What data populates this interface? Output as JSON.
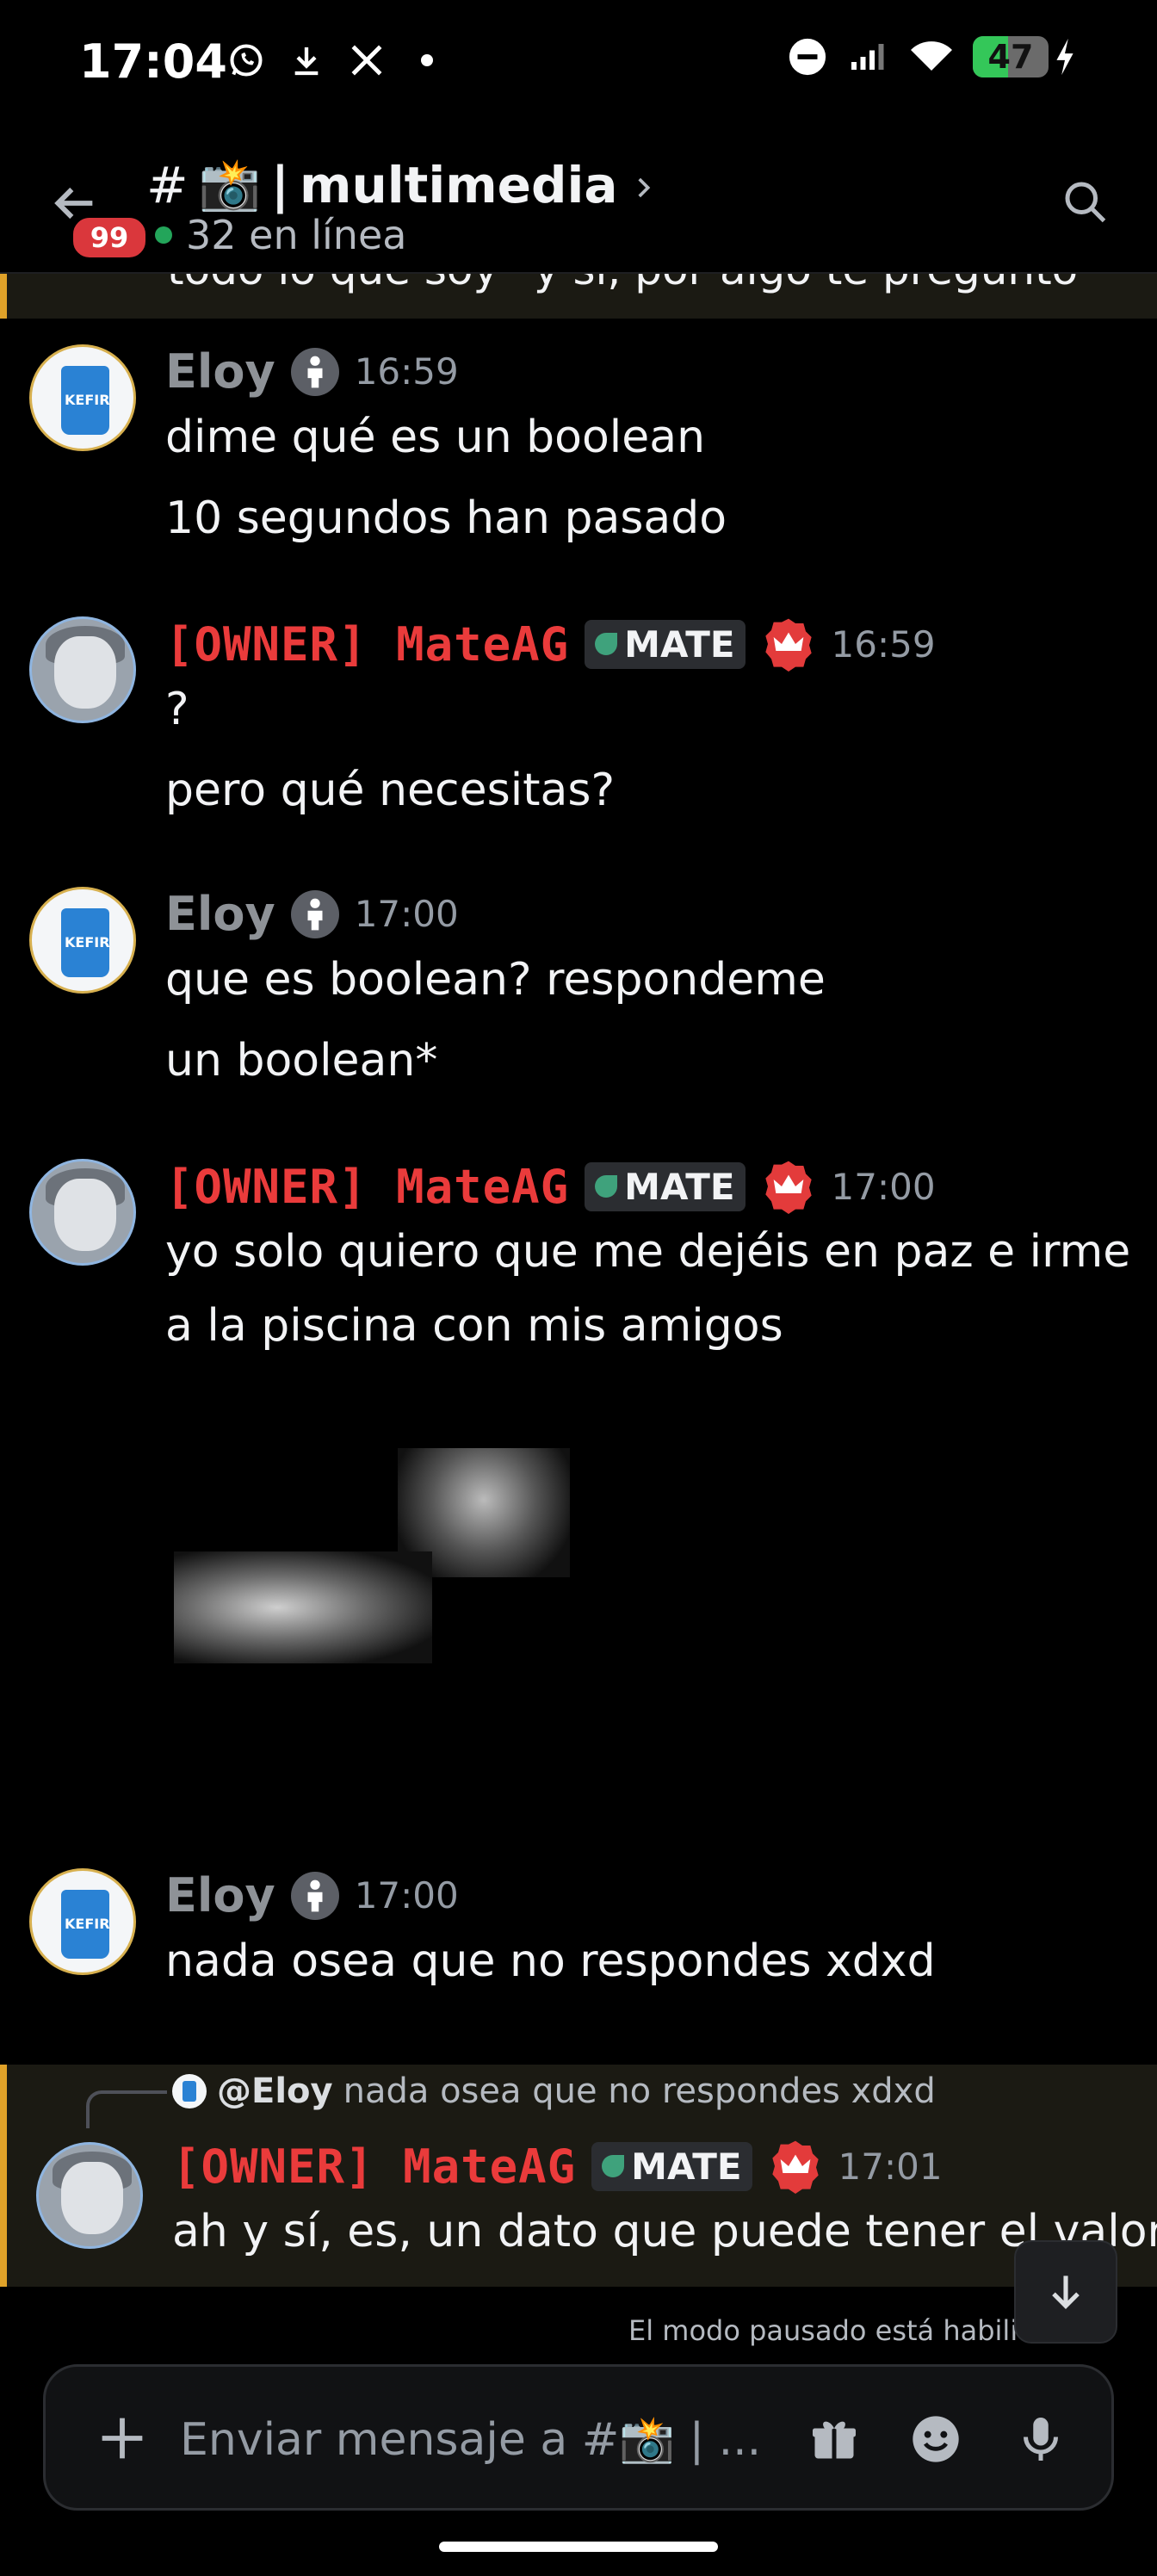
{
  "status_bar": {
    "time": "17:04",
    "left_icons": [
      "whatsapp-icon",
      "download-icon",
      "x-icon",
      "dot-icon"
    ],
    "right_icons": [
      "dnd-icon",
      "signal-icon",
      "wifi-icon",
      "battery-icon",
      "charging-icon"
    ],
    "battery_percent": "47",
    "battery_level": 0.47
  },
  "header": {
    "hash": "#",
    "channel_emoji": "📸",
    "separator": "|",
    "channel_name": "multimedia",
    "online_count": "32 en línea",
    "unread_badge": "99"
  },
  "cut_message": {
    "text": "todo lo que soy* y si, por algo te pregunto"
  },
  "messages": [
    {
      "author": "Eloy",
      "time": "16:59",
      "lines": [
        "dime qué es un boolean",
        "10 segundos han pasado"
      ]
    },
    {
      "author": "[OWNER] MateAG",
      "tag": "MATE",
      "time": "16:59",
      "lines": [
        "?",
        "pero qué necesitas?"
      ]
    },
    {
      "author": "Eloy",
      "time": "17:00",
      "lines": [
        "que es boolean? respondeme",
        "un boolean*"
      ]
    },
    {
      "author": "[OWNER] MateAG",
      "tag": "MATE",
      "time": "17:00",
      "lines": [
        "yo solo quiero que me dejéis en paz e irme",
        "a la piscina con mis amigos"
      ]
    },
    {
      "author": "Eloy",
      "time": "17:00",
      "lines": [
        "nada osea que no respondes xdxd"
      ]
    },
    {
      "author": "[OWNER] MateAG",
      "tag": "MATE",
      "time": "17:01",
      "lines": [
        "ah y sí, es, un dato que puede tener el valor"
      ],
      "reply": {
        "author": "@Eloy",
        "text": "nada osea que no respondes xdxd"
      }
    }
  ],
  "paused_notice": "El modo pausado está habilitado",
  "composer": {
    "placeholder": "Enviar mensaje a #📸 | ...",
    "icons": [
      "plus-icon",
      "gift-icon",
      "emoji-icon",
      "microphone-icon"
    ]
  },
  "colors": {
    "background": "#000000",
    "owner_name": "#ea3b3b",
    "eloy_name": "#8e9297",
    "highlight_bar": "#e0a229",
    "online": "#23a55a",
    "badge": "#da373c",
    "battery": "#34c759"
  }
}
